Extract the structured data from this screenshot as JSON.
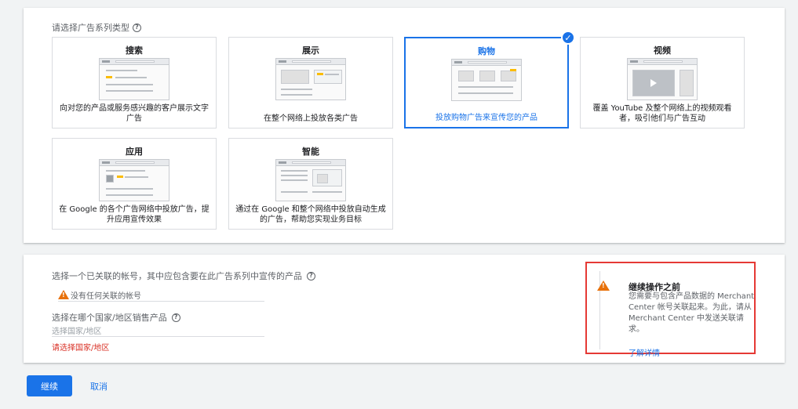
{
  "campaign_type": {
    "section_title": "请选择广告系列类型",
    "tiles": [
      {
        "title": "搜索",
        "desc": "向对您的产品或服务感兴趣的客户展示文字广告"
      },
      {
        "title": "展示",
        "desc": "在整个网络上投放各类广告"
      },
      {
        "title": "购物",
        "desc": "投放购物广告来宣传您的产品"
      },
      {
        "title": "视频",
        "desc": "覆盖 YouTube 及整个网络上的视频观看者，吸引他们与广告互动"
      },
      {
        "title": "应用",
        "desc": "在 Google 的各个广告网络中投放广告，提升应用宣传效果"
      },
      {
        "title": "智能",
        "desc": "通过在 Google 和整个网络中投放自动生成的广告，帮助您实现业务目标"
      }
    ],
    "selected": "购物"
  },
  "account": {
    "label": "选择一个已关联的帐号，其中应包含要在此广告系列中宣传的产品",
    "no_account_warning": "没有任何关联的帐号",
    "country_label": "选择在哪个国家/地区销售产品",
    "country_placeholder": "选择国家/地区",
    "country_error": "请选择国家/地区"
  },
  "callout": {
    "title": "继续操作之前",
    "body": "您需要与包含产品数据的 Merchant Center 帐号关联起来。为此，请从 Merchant Center 中发送关联请求。",
    "link": "了解详情"
  },
  "actions": {
    "continue": "继续",
    "cancel": "取消"
  },
  "colors": {
    "accent": "#1a73e8",
    "warning": "#e8710a",
    "error": "#d93025",
    "callout_border": "#e53935"
  }
}
